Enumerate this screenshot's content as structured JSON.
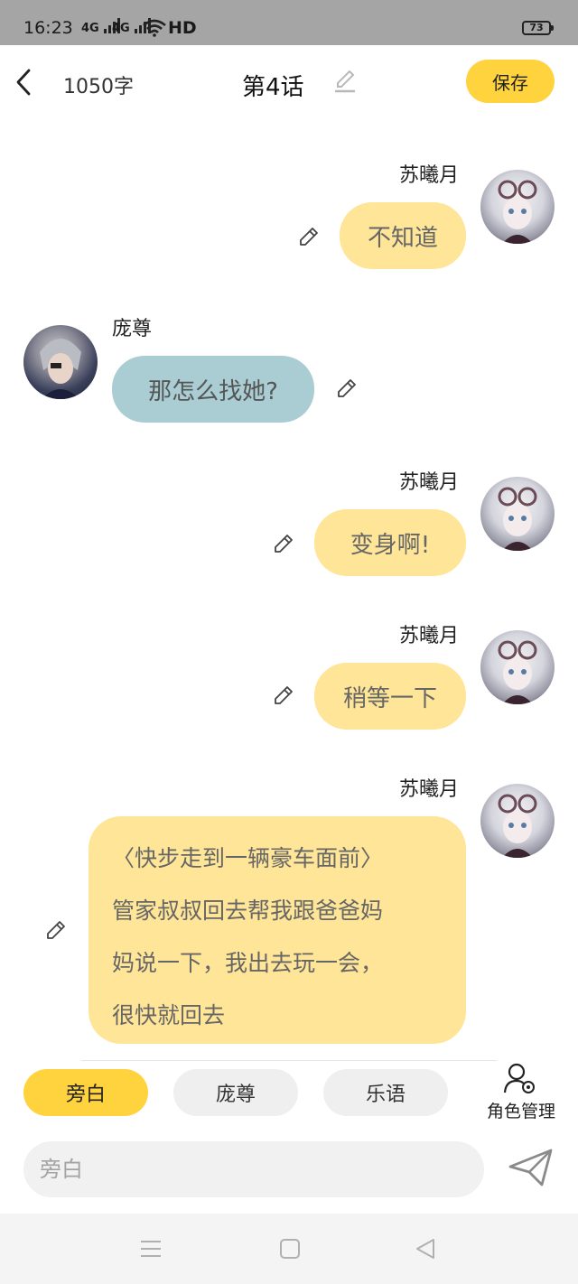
{
  "status_bar": {
    "time": "16:23",
    "signal1": "4G",
    "signal2": "4G",
    "network": "HD",
    "battery": "73"
  },
  "header": {
    "word_count": "1050字",
    "title": "第4话",
    "save_label": "保存"
  },
  "messages": [
    {
      "speaker": "苏曦月",
      "side": "right",
      "text": "不知道",
      "color": "#ffe597"
    },
    {
      "speaker": "庞尊",
      "side": "left",
      "text": "那怎么找她?",
      "color": "#a9cdd3"
    },
    {
      "speaker": "苏曦月",
      "side": "right",
      "text": "变身啊!",
      "color": "#ffe597"
    },
    {
      "speaker": "苏曦月",
      "side": "right",
      "text": "稍等一下",
      "color": "#ffe597"
    },
    {
      "speaker": "苏曦月",
      "side": "right",
      "lines": [
        "〈快步走到一辆豪车面前〉",
        "管家叔叔回去帮我跟爸爸妈",
        "妈说一下，我出去玩一会，",
        "很快就回去"
      ],
      "color": "#ffe597"
    }
  ],
  "roles": {
    "tabs": [
      "旁白",
      "庞尊",
      "乐语"
    ],
    "active": 0,
    "manage_label": "角色管理"
  },
  "input": {
    "placeholder": "旁白"
  },
  "colors": {
    "accent": "#ffd33d",
    "bubble_mine": "#ffe597",
    "bubble_other": "#a9cdd3"
  },
  "icons": [
    "back-icon",
    "edit-icon",
    "pencil-icon",
    "role-manage-icon",
    "send-icon",
    "menu-icon",
    "home-icon",
    "back-nav-icon"
  ]
}
